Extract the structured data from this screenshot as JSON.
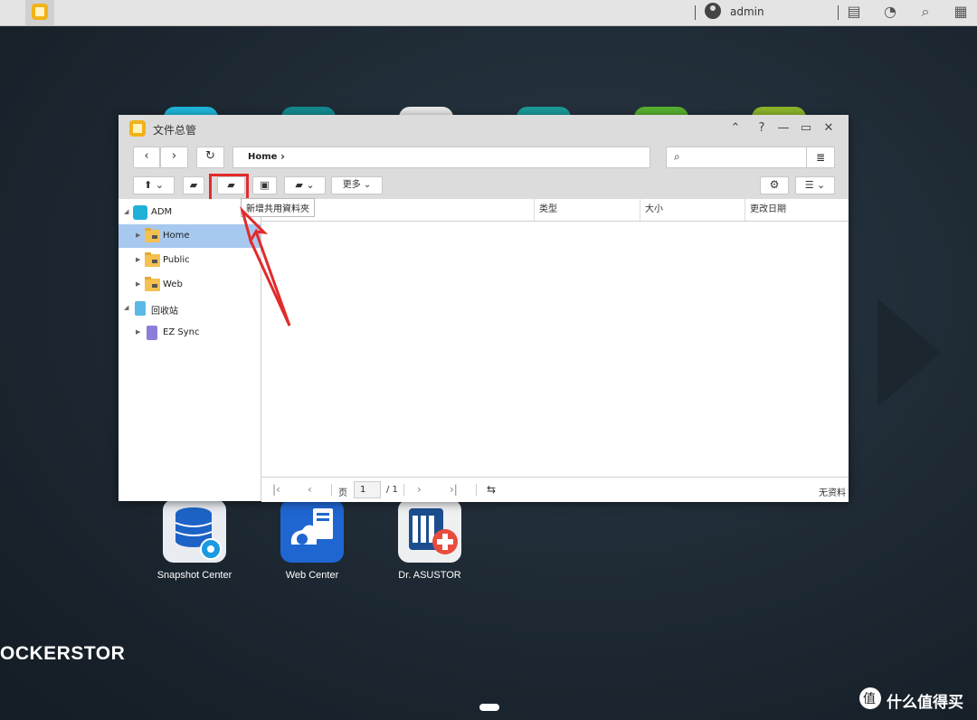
{
  "topbar": {
    "username": "admin"
  },
  "window": {
    "title": "文件总管",
    "breadcrumb": "Home",
    "more_label": "更多",
    "tooltip": "新增共用資料夾"
  },
  "tree": {
    "root": "ADM",
    "items": [
      "Home",
      "Public",
      "Web"
    ],
    "recycle": "回收站",
    "recycle_items": [
      "EZ Sync"
    ]
  },
  "columns": [
    "类型",
    "大小",
    "更改日期"
  ],
  "pager": {
    "page_label": "页",
    "page_value": "1",
    "total": "/ 1",
    "status": "无资料"
  },
  "desktop": {
    "apps": [
      "Snapshot Center",
      "Web Center",
      "Dr. ASUSTOR"
    ],
    "brand": "OCKERSTOR",
    "watermark": "什么值得买"
  },
  "colors": {
    "highlight": "#e32a2a",
    "selected": "#a8c9ef",
    "folder": "#f4c150"
  }
}
